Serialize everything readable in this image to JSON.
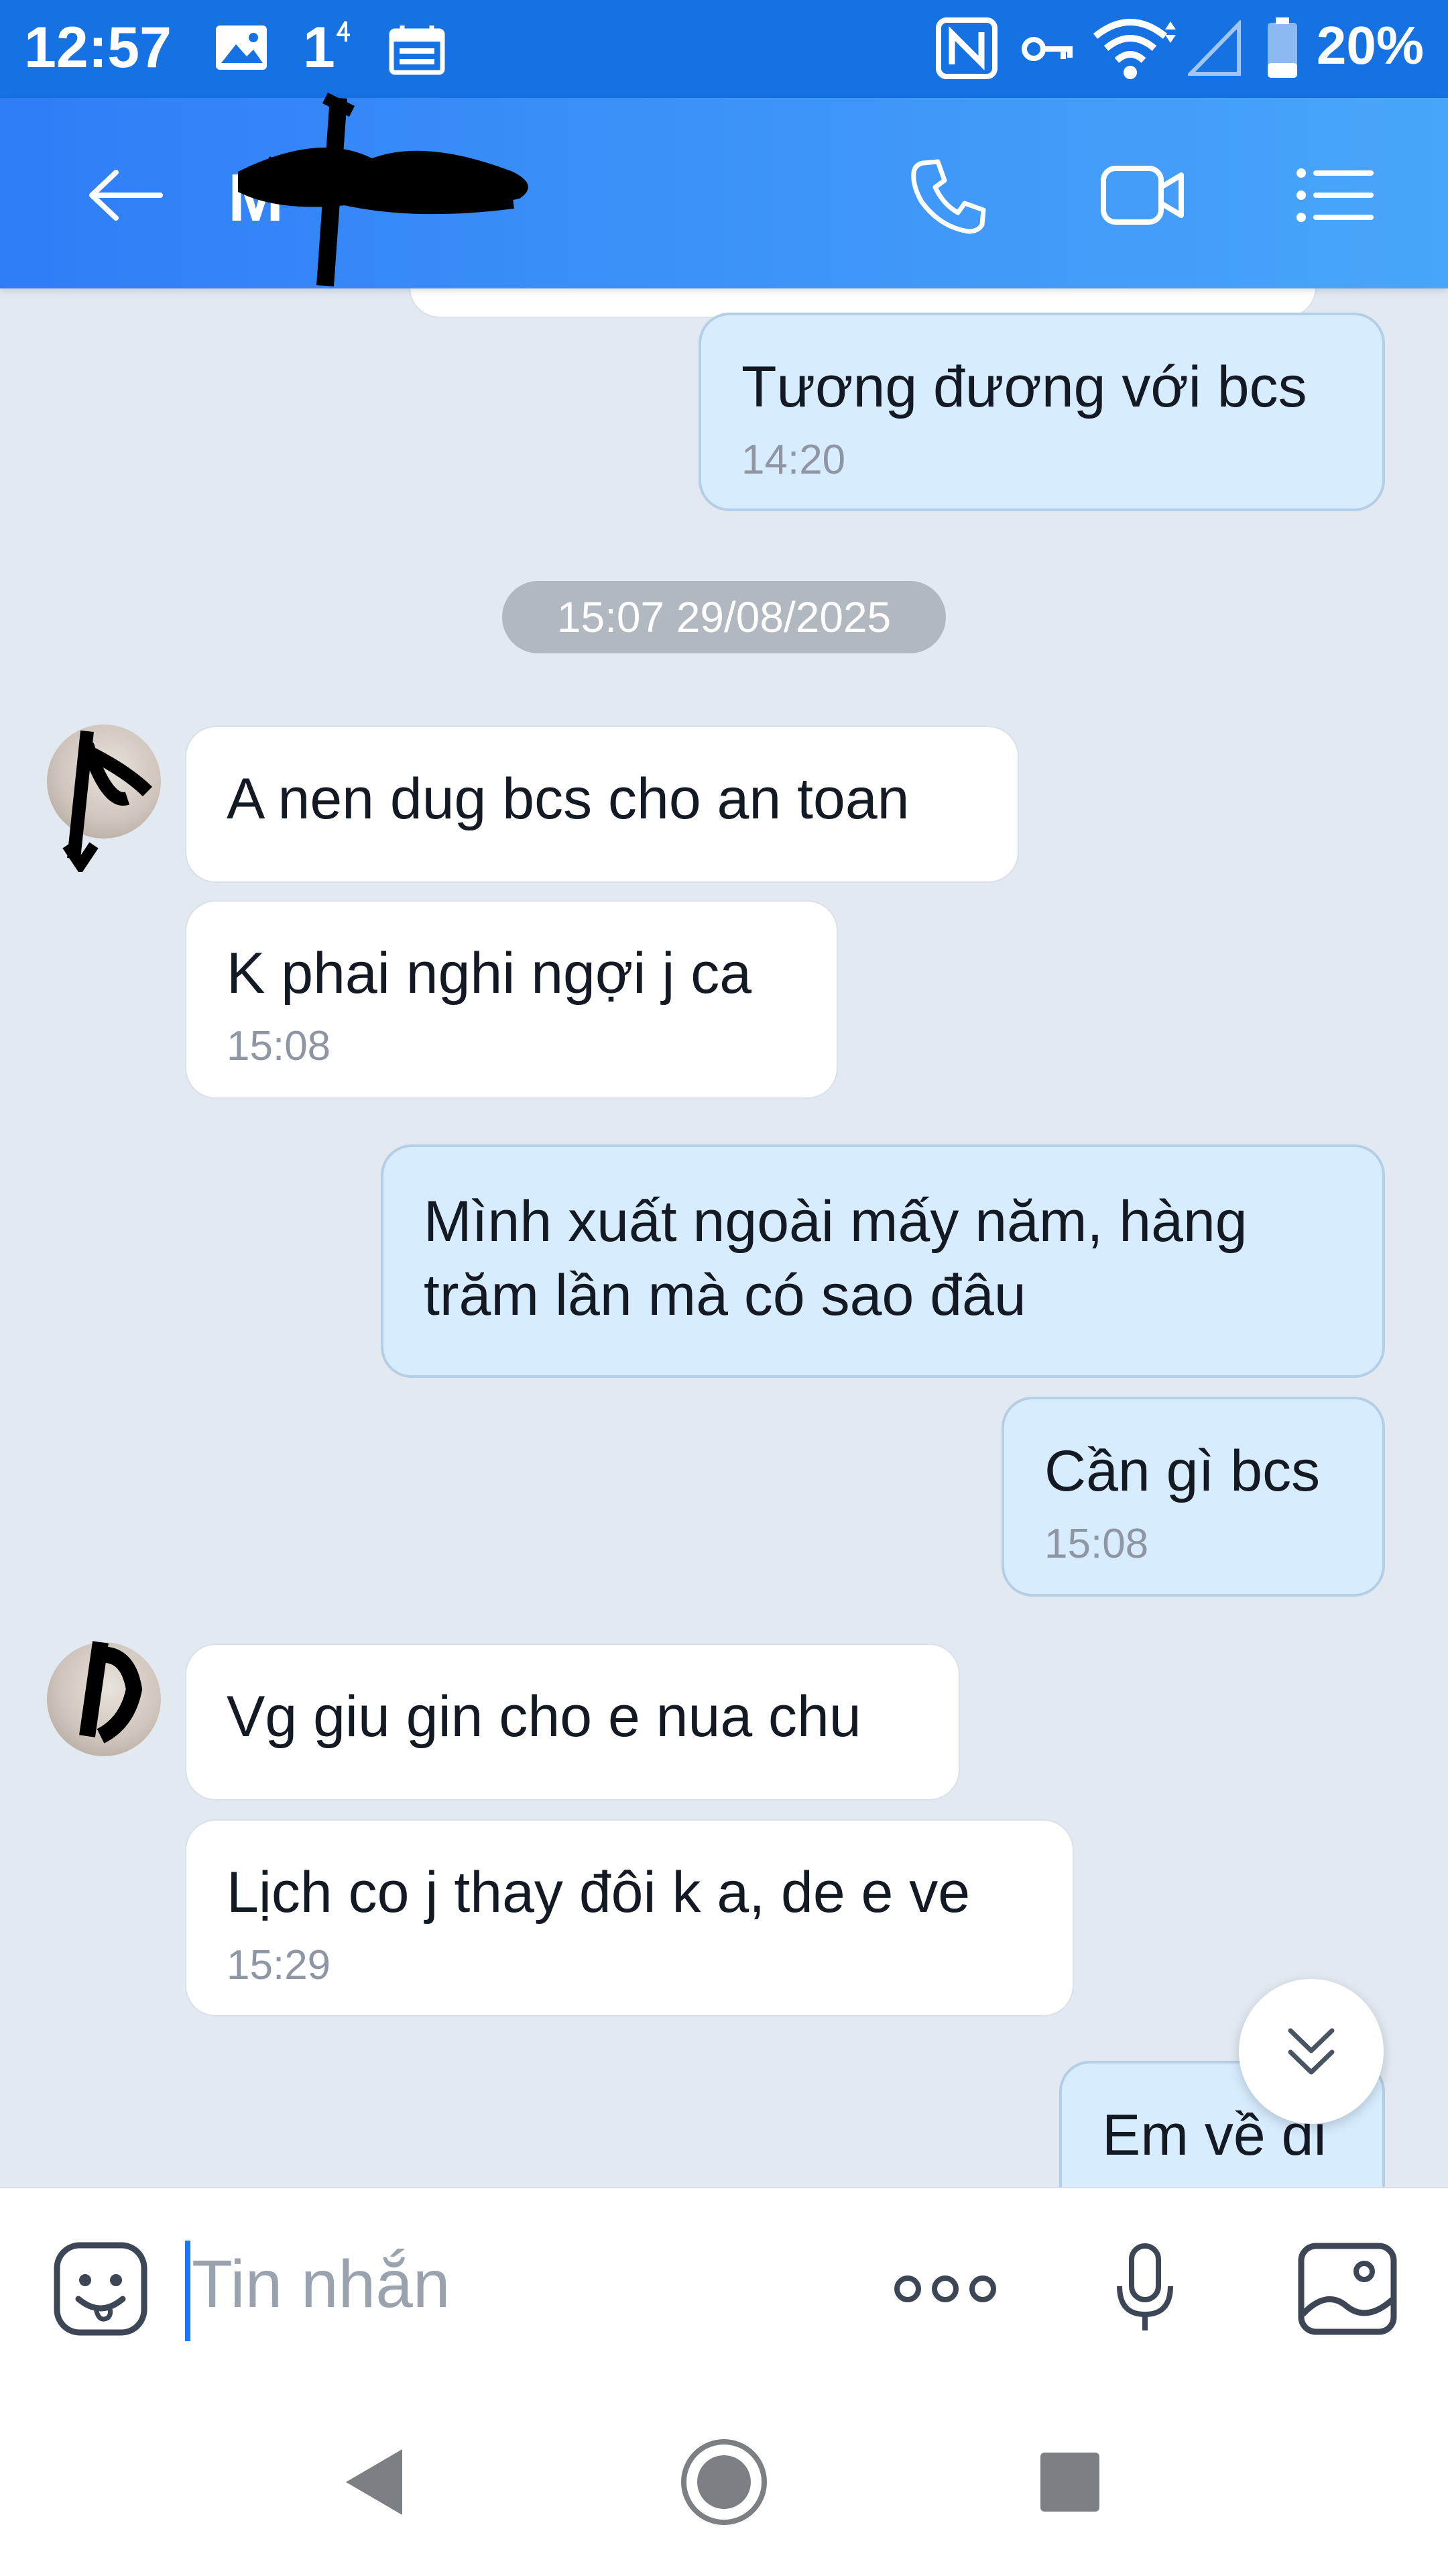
{
  "status_bar": {
    "time": "12:57",
    "notification_count": "1",
    "battery_percent": "20%"
  },
  "header": {
    "contact_name_visible": "M",
    "icons": [
      "back-arrow-icon",
      "phone-icon",
      "video-call-icon",
      "menu-list-icon"
    ]
  },
  "messages": [
    {
      "direction": "out",
      "text": "Tương đương với bcs",
      "time": "14:20"
    },
    {
      "type": "date",
      "text": "15:07 29/08/2025"
    },
    {
      "direction": "in",
      "text": "A nen dug bcs cho an toan"
    },
    {
      "direction": "in",
      "text": "K phai nghi ngợi j ca",
      "time": "15:08"
    },
    {
      "direction": "out",
      "text": "Mình xuất ngoài mấy năm, hàng trăm lần mà có sao đâu"
    },
    {
      "direction": "out",
      "text": "Cần gì bcs",
      "time": "15:08"
    },
    {
      "direction": "in",
      "text": "Vg giu gin cho e nua chu"
    },
    {
      "direction": "in",
      "text": "Lịch co j thay đôi k a, de e ve",
      "time": "15:29"
    },
    {
      "direction": "out",
      "text": "Em về đi"
    }
  ],
  "input": {
    "placeholder": "Tin nhắn"
  },
  "colors": {
    "header_start": "#2f7df7",
    "header_end": "#49a5f9",
    "status_bar": "#1672e2",
    "chat_background": "#e2e9f1",
    "outgoing_bubble": "#d7edff",
    "incoming_bubble": "#ffffff",
    "caret": "#1677ff"
  }
}
